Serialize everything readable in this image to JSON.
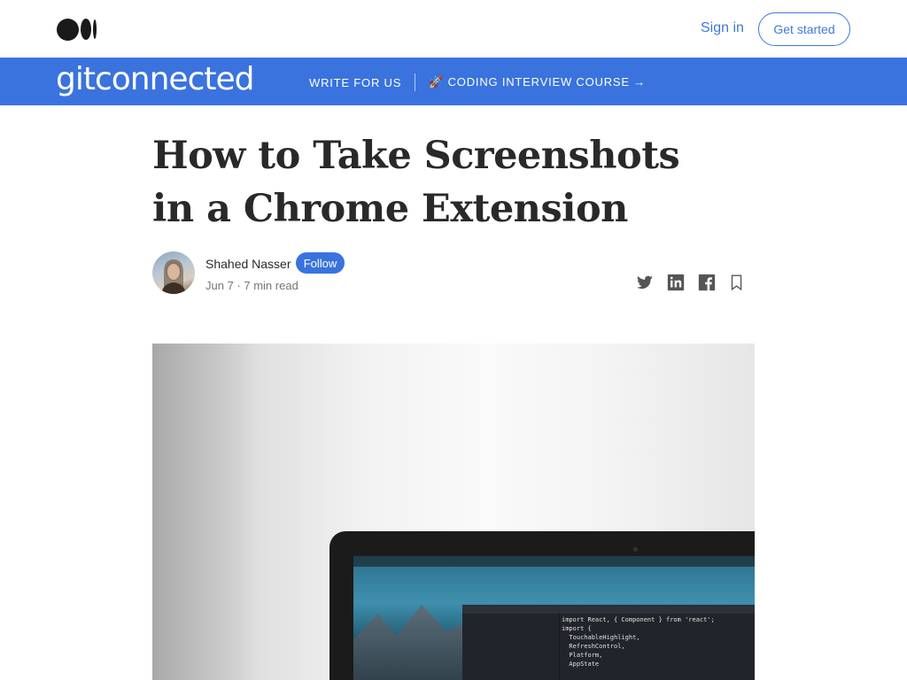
{
  "header": {
    "logo_icon": "medium-logo",
    "sign_in_label": "Sign in",
    "get_started_label": "Get started"
  },
  "publication": {
    "name": "gitconnected",
    "nav": [
      {
        "label": "WRITE FOR US"
      },
      {
        "label": "🚀 CODING INTERVIEW COURSE →"
      }
    ],
    "color": "#3a73de"
  },
  "article": {
    "title": "How to Take Screenshots in a Chrome Extension",
    "author": "Shahed Nasser",
    "follow_label": "Follow",
    "date": "Jun 7",
    "read_time": "7 min read",
    "share_icons": [
      "twitter-icon",
      "linkedin-icon",
      "facebook-icon",
      "bookmark-icon"
    ]
  },
  "hero_code": {
    "lines": [
      "import React, { Component } from 'react';",
      "import {",
      "  TouchableHighlight,",
      "  RefreshControl,",
      "  Platform,",
      "  AppState"
    ]
  },
  "accent_color": "#3a7ad9"
}
